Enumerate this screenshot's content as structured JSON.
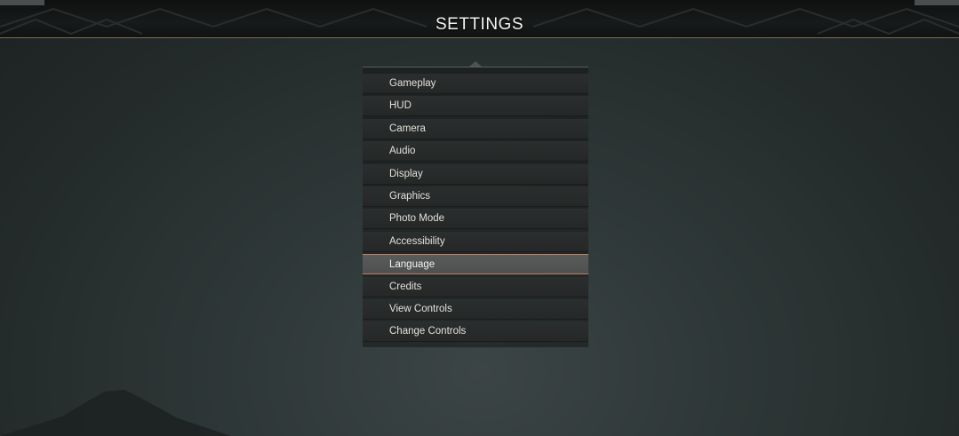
{
  "header": {
    "title": "SETTINGS"
  },
  "menu": {
    "items": [
      {
        "label": "Gameplay",
        "selected": false
      },
      {
        "label": "HUD",
        "selected": false
      },
      {
        "label": "Camera",
        "selected": false
      },
      {
        "label": "Audio",
        "selected": false
      },
      {
        "label": "Display",
        "selected": false
      },
      {
        "label": "Graphics",
        "selected": false
      },
      {
        "label": "Photo Mode",
        "selected": false
      },
      {
        "label": "Accessibility",
        "selected": false
      },
      {
        "label": "Language",
        "selected": true
      },
      {
        "label": "Credits",
        "selected": false
      },
      {
        "label": "View Controls",
        "selected": false
      },
      {
        "label": "Change Controls",
        "selected": false
      }
    ]
  },
  "colors": {
    "selection_accent": "#c08060",
    "header_rule": "#7a6a52"
  }
}
